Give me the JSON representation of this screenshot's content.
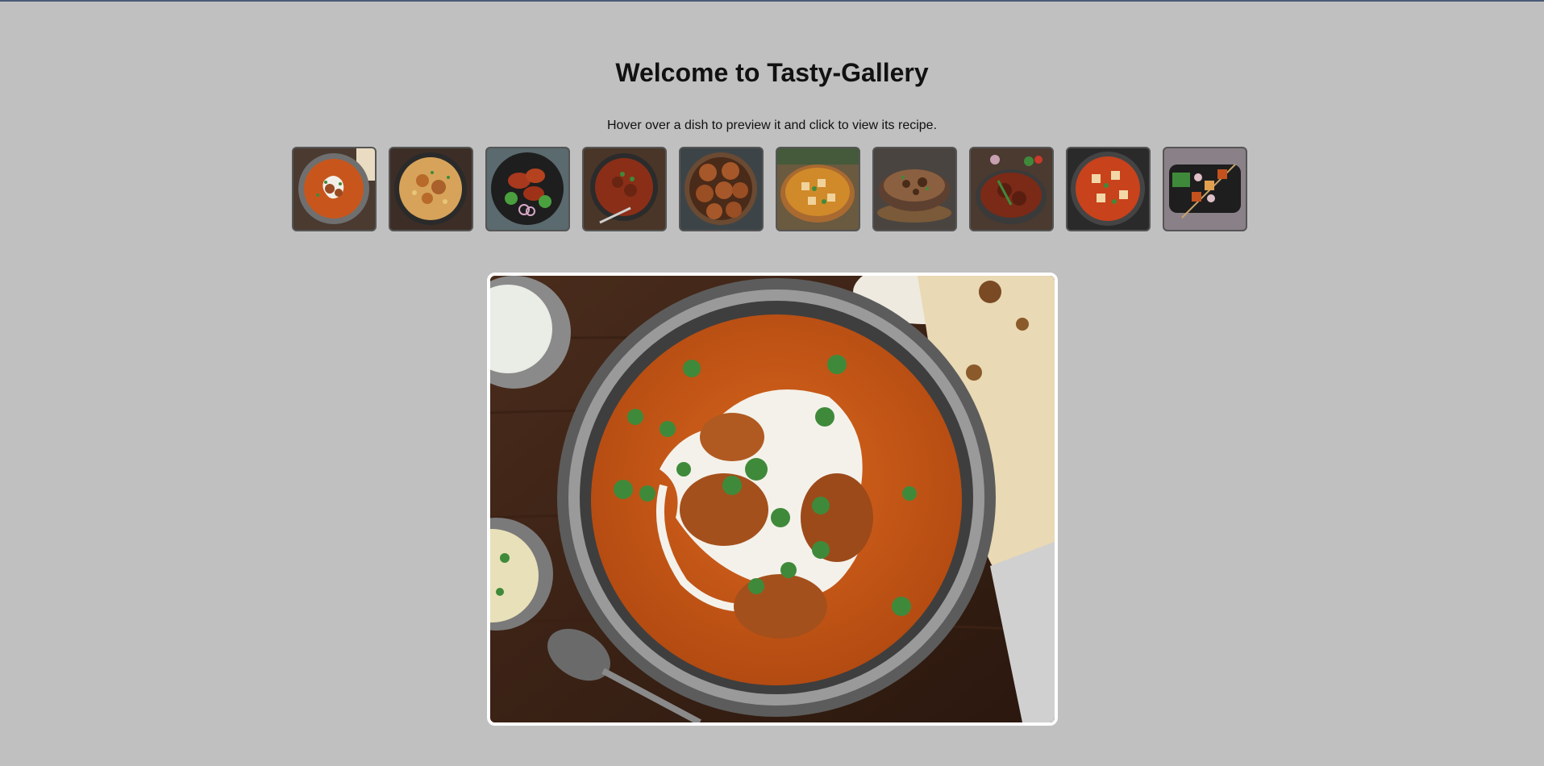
{
  "page": {
    "title": "Welcome to Tasty-Gallery",
    "instructions": "Hover over a dish to preview it and click to view its recipe."
  },
  "gallery": {
    "thumbnails": [
      {
        "dish": "butter-chicken",
        "icon": "curry-bowl-icon"
      },
      {
        "dish": "biryani",
        "icon": "rice-bowl-icon"
      },
      {
        "dish": "tandoori-chicken",
        "icon": "grilled-chicken-icon"
      },
      {
        "dish": "mutton-curry",
        "icon": "curry-bowl-icon"
      },
      {
        "dish": "gulab-jamun",
        "icon": "dessert-bowl-icon"
      },
      {
        "dish": "paneer-curry",
        "icon": "paneer-bowl-icon"
      },
      {
        "dish": "mutton-biryani",
        "icon": "rice-platter-icon"
      },
      {
        "dish": "rogan-josh",
        "icon": "curry-bowl-icon"
      },
      {
        "dish": "paneer-masala",
        "icon": "paneer-bowl-icon"
      },
      {
        "dish": "paneer-tikka",
        "icon": "skewer-icon"
      }
    ],
    "selected_index": 0
  },
  "colors": {
    "background": "#c0c0c0",
    "thumb_border": "#555555",
    "preview_border": "#ffffff",
    "curry": "#c8561c",
    "cream": "#f4f1ea",
    "cilantro": "#3f8a3a"
  }
}
